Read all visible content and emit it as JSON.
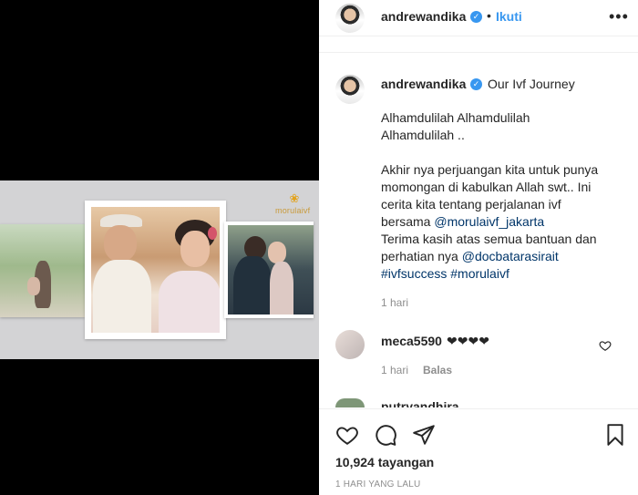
{
  "post": {
    "username": "andrewandika",
    "follow_label": "Ikuti",
    "more_label": "•••",
    "separator": "•"
  },
  "caption": {
    "username": "andrewandika",
    "title": "Our Ivf Journey",
    "para1_line1": "Alhamdulilah Alhamdulilah",
    "para1_line2": "Alhamdulilah ..",
    "line1": "Akhir nya perjuangan kita untuk punya",
    "line2": "momongan di kabulkan Allah swt.. Ini",
    "line3": "cerita kita tentang perjalanan ivf",
    "line4_prefix": "bersama ",
    "line4_mention": "@morulaivf_jakarta",
    "line5": "Terima kasih atas semua bantuan dan",
    "line6_prefix": "perhatian nya ",
    "line6_mention": "@docbatarasirait",
    "line7_tags": "#ivfsuccess #morulaivf",
    "time": "1 hari"
  },
  "comments": [
    {
      "username": "meca5590",
      "text": "❤❤❤❤",
      "time": "1 hari",
      "reply_label": "Balas"
    },
    {
      "username": "putryandhira"
    }
  ],
  "footer": {
    "views": "10,924 tayangan",
    "timestamp": "1 HARI YANG LALU"
  },
  "media": {
    "brand": "morulaivf"
  },
  "colors": {
    "accent": "#3897f0",
    "mention": "#003569",
    "muted": "#8e8e8e",
    "text": "#262626"
  }
}
